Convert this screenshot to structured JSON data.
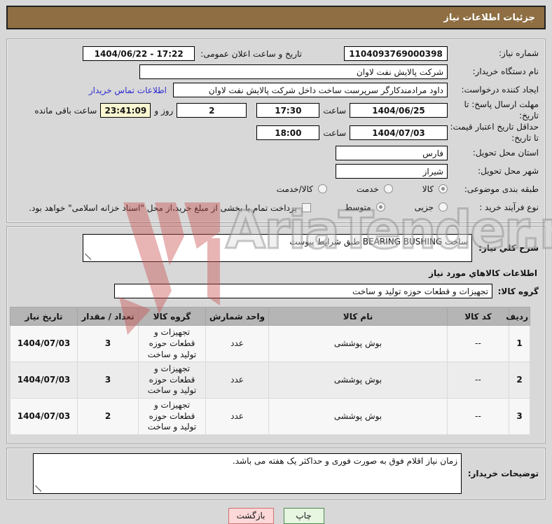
{
  "title": "جزئیات اطلاعات نیاز",
  "form": {
    "need_number_label": "شماره نیاز:",
    "need_number": "1104093769000398",
    "announce_label": "تاریخ و ساعت اعلان عمومی:",
    "announce_value": "1404/06/22 - 17:22",
    "buyer_org_label": "نام دستگاه خریدار:",
    "buyer_org": "شرکت پالایش نفت لاوان",
    "creator_label": "ایجاد کننده درخواست:",
    "creator": "داود مرادمندکارگر سرپرست ساخت داخل شرکت پالایش نفت لاوان",
    "contact_link": "اطلاعات تماس خریدار",
    "deadline_label": "مهلت ارسال پاسخ: تا تاریخ:",
    "deadline_date": "1404/06/25",
    "hour_label": "ساعت",
    "deadline_time": "17:30",
    "days_value": "2",
    "days_label": "روز و",
    "countdown": "23:41:09",
    "countdown_label": "ساعت باقی مانده",
    "price_validity_label": "حداقل تاریخ اعتبار قیمت: تا تاریخ:",
    "price_validity_date": "1404/07/03",
    "price_validity_time": "18:00",
    "province_label": "استان محل تحویل:",
    "province": "فارس",
    "city_label": "شهر محل تحویل:",
    "city": "شیراز",
    "classification_label": "طبقه بندی موضوعی:",
    "classification_options": [
      {
        "label": "کالا",
        "selected": true
      },
      {
        "label": "خدمت",
        "selected": false
      },
      {
        "label": "کالا/خدمت",
        "selected": false
      }
    ],
    "process_label": "نوع فرآیند خرید :",
    "process_options": [
      {
        "label": "جزیی",
        "selected": false
      },
      {
        "label": "متوسط",
        "selected": true
      }
    ],
    "treasury_note": "پرداخت تمام یا بخشی از مبلغ خرید،از محل \"اسناد خزانه اسلامی\" خواهد بود."
  },
  "description_section": {
    "label": "شرح کلي نیاز:",
    "value": "ساخت BEARING BUSHING  طبق شرایط پیوست"
  },
  "goods_section": {
    "header": "اطلاعات کالاهاي مورد نیاز",
    "group_label": "گروه کالا:",
    "group_value": "تجهیزات و قطعات حوزه تولید و ساخت",
    "table": {
      "headers": [
        "ردیف",
        "کد کالا",
        "نام کالا",
        "واحد شمارش",
        "گروه کالا",
        "تعداد / مقدار",
        "تاریخ نیاز"
      ],
      "rows": [
        [
          "1",
          "--",
          "بوش پوششی",
          "عدد",
          "تجهیزات و قطعات حوزه تولید و ساخت",
          "3",
          "1404/07/03"
        ],
        [
          "2",
          "--",
          "بوش پوششی",
          "عدد",
          "تجهیزات و قطعات حوزه تولید و ساخت",
          "3",
          "1404/07/03"
        ],
        [
          "3",
          "--",
          "بوش پوششی",
          "عدد",
          "تجهیزات و قطعات حوزه تولید و ساخت",
          "2",
          "1404/07/03"
        ]
      ]
    }
  },
  "notes_section": {
    "label": "توضیحات خریدار:",
    "value": "زمان نیاز اقلام فوق به صورت فوری و حداکثر یک هفته می باشد."
  },
  "buttons": {
    "print": "چاپ",
    "back": "بازگشت"
  },
  "watermark": {
    "text": "AriaTender.neT"
  },
  "colors": {
    "title_bg": "#8e6e42",
    "link": "#2d2dd2",
    "countdown_bg": "#fbf7d2",
    "btn_print_bg": "#e7f6e1",
    "btn_print_border": "#4d8a4d",
    "btn_back_bg": "#fcd8d8",
    "btn_back_border": "#cf7070",
    "watermark_red": "#c94f4f"
  }
}
